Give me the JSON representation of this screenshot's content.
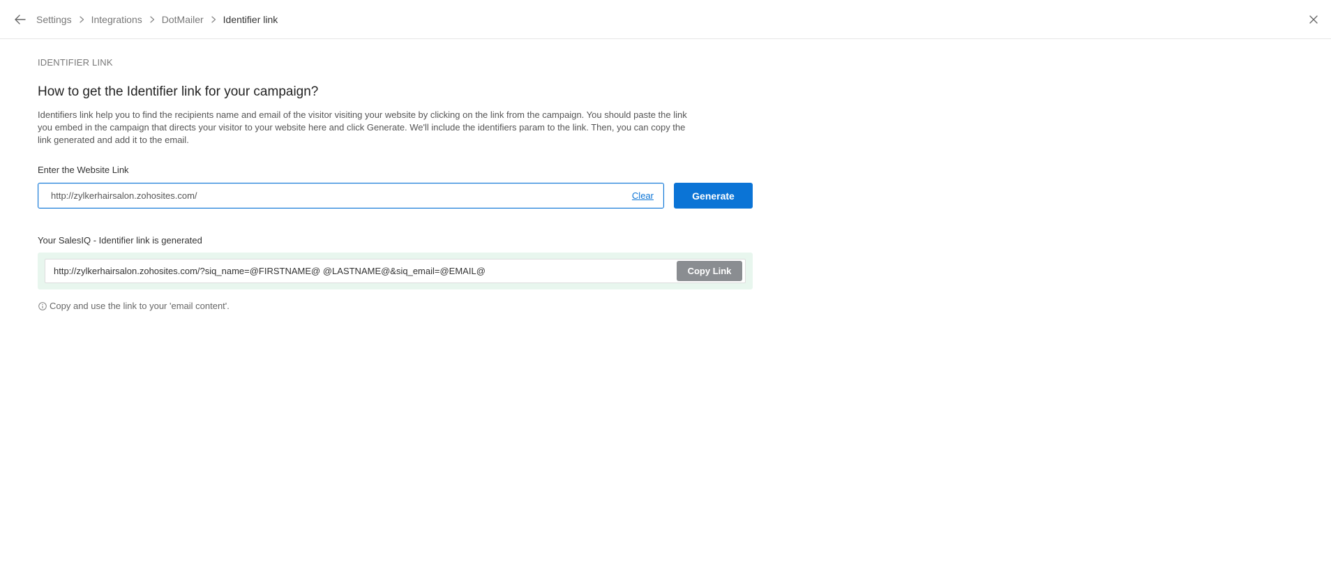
{
  "header": {
    "breadcrumbs": [
      {
        "label": "Settings"
      },
      {
        "label": "Integrations"
      },
      {
        "label": "DotMailer"
      },
      {
        "label": "Identifier link"
      }
    ]
  },
  "main": {
    "section_label": "IDENTIFIER LINK",
    "heading": "How to get the Identifier link for your campaign?",
    "description": "Identifiers link help you to find the recipients name and email of the visitor visiting your website by clicking on the link from the campaign. You should paste the link you embed in the campaign that directs your visitor to your website here and click Generate. We'll include the identifiers param to the link. Then, you can copy the link generated and add it to the email.",
    "website_field": {
      "label": "Enter the Website Link",
      "value": "http://zylkerhairsalon.zohosites.com/",
      "clear_label": "Clear",
      "generate_label": "Generate"
    },
    "generated": {
      "label": "Your SalesIQ - Identifier link is generated",
      "link": "http://zylkerhairsalon.zohosites.com/?siq_name=@FIRSTNAME@ @LASTNAME@&siq_email=@EMAIL@",
      "copy_label": "Copy Link"
    },
    "note": "Copy and use the link to your 'email content'."
  },
  "colors": {
    "accent": "#0b74d6",
    "success_bg": "#e8f6ee",
    "disabled_button": "#8a8d91"
  }
}
